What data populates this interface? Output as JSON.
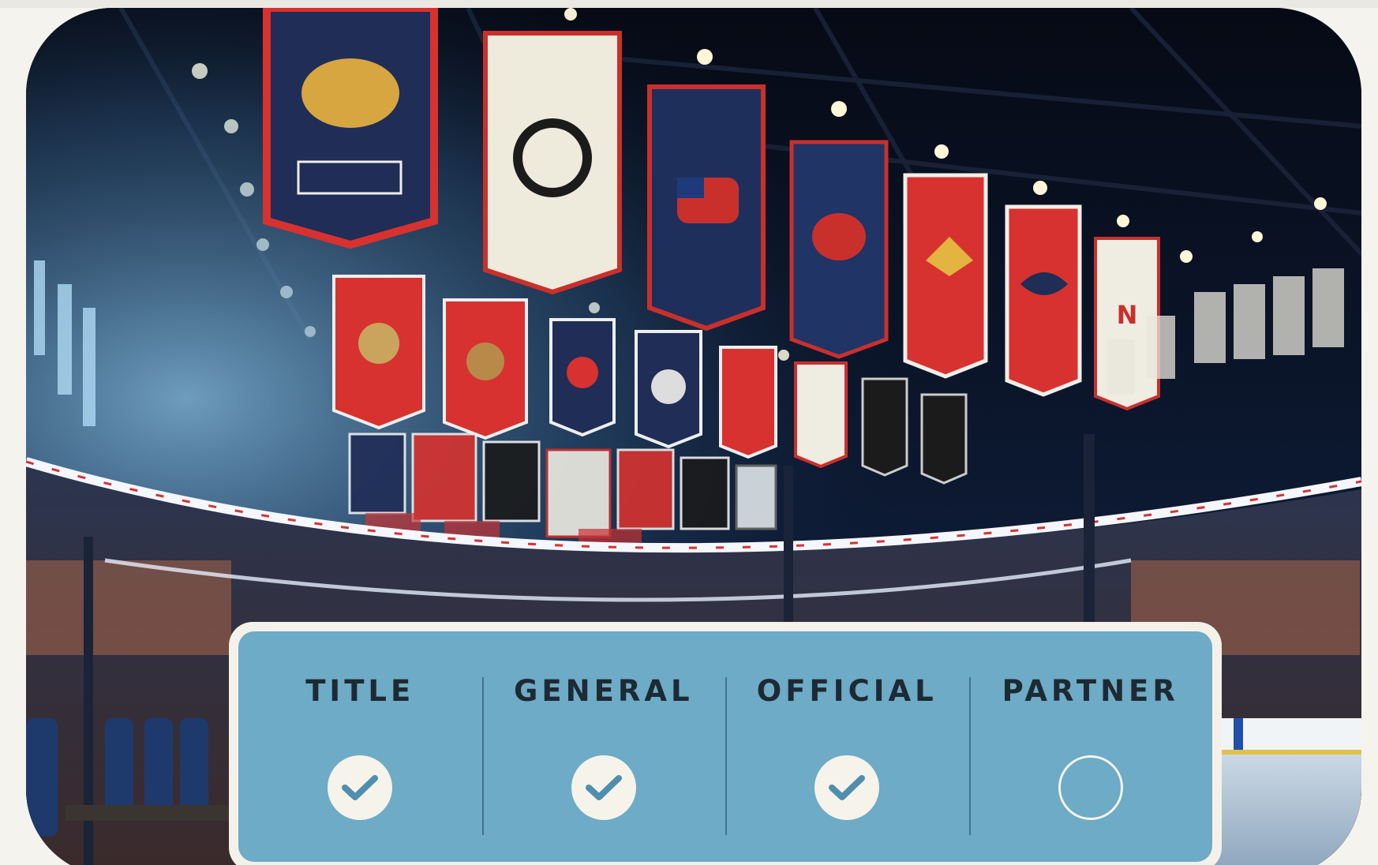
{
  "hero": {
    "photo": "arena-banners-photo"
  },
  "tiers": [
    {
      "label": "TITLE",
      "included": true,
      "icon": "checkmark-icon"
    },
    {
      "label": "GENERAL",
      "included": true,
      "icon": "checkmark-icon"
    },
    {
      "label": "OFFICIAL",
      "included": true,
      "icon": "checkmark-icon"
    },
    {
      "label": "PARTNER",
      "included": false,
      "icon": "empty-circle-icon"
    }
  ],
  "colors": {
    "panel_fill": "#6dabc6",
    "panel_border": "#f3f1e9",
    "label_text": "#1d2a33",
    "check_fill": "#f5f3ea",
    "check_mark": "#4f8fae"
  }
}
